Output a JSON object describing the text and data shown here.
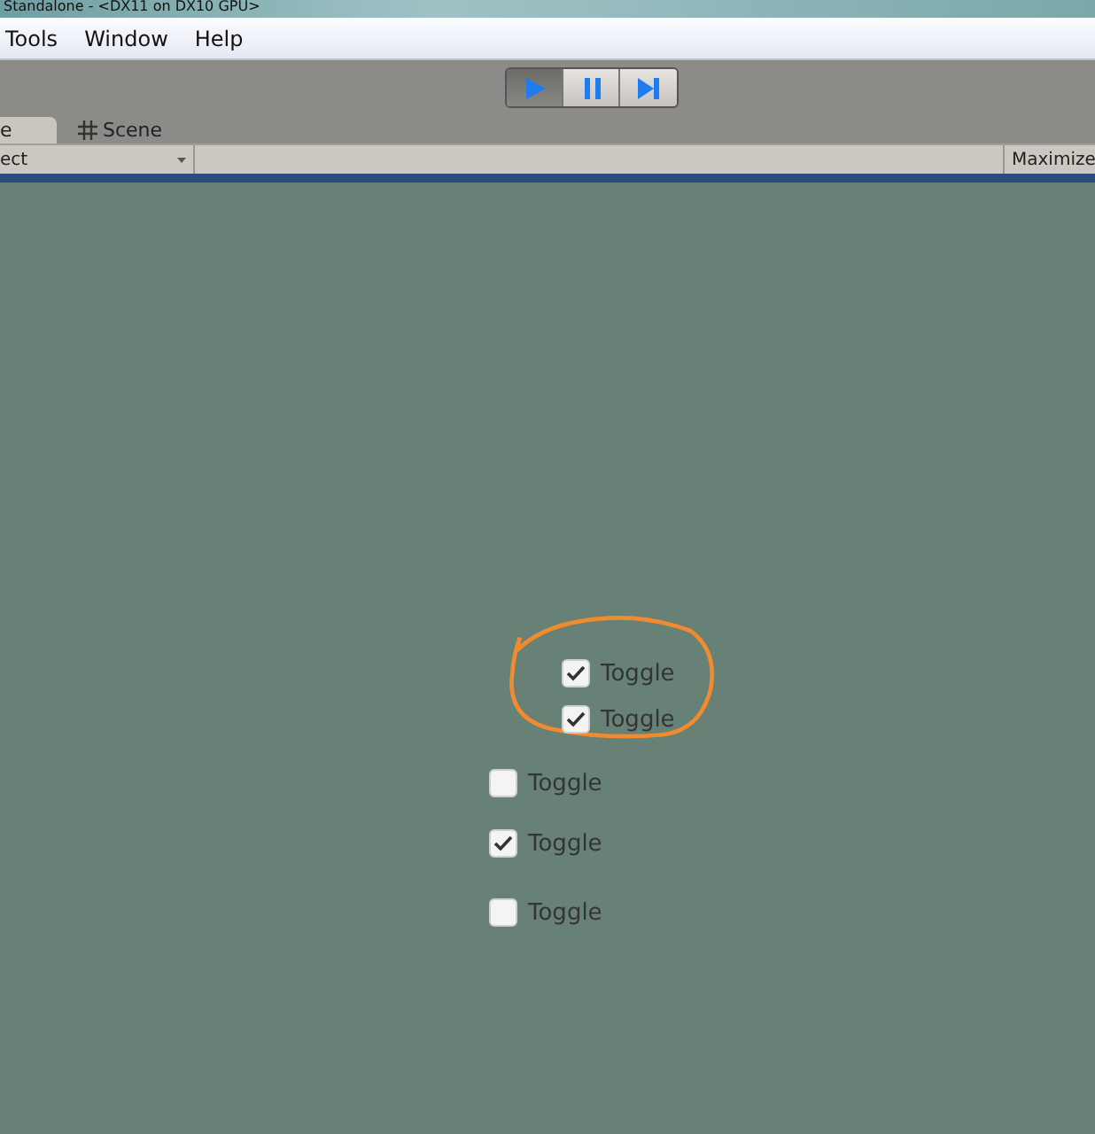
{
  "window": {
    "title": "Standalone - <DX11 on DX10 GPU>"
  },
  "menu": [
    "Tools",
    "Window",
    "Help"
  ],
  "playback_buttons": [
    {
      "kind": "play",
      "selected": true
    },
    {
      "kind": "pause",
      "selected": false
    },
    {
      "kind": "step",
      "selected": false
    }
  ],
  "tabs": [
    {
      "label": "e",
      "kind": "game",
      "selected": true
    },
    {
      "label": "Scene",
      "kind": "scene",
      "selected": false
    }
  ],
  "game_toolbar": {
    "aspect": "ect",
    "maximize": "Maximize"
  },
  "toggles": [
    {
      "label": "Toggle",
      "checked": true
    },
    {
      "label": "Toggle",
      "checked": true
    },
    {
      "label": "Toggle",
      "checked": false
    },
    {
      "label": "Toggle",
      "checked": true
    },
    {
      "label": "Toggle",
      "checked": false
    }
  ]
}
